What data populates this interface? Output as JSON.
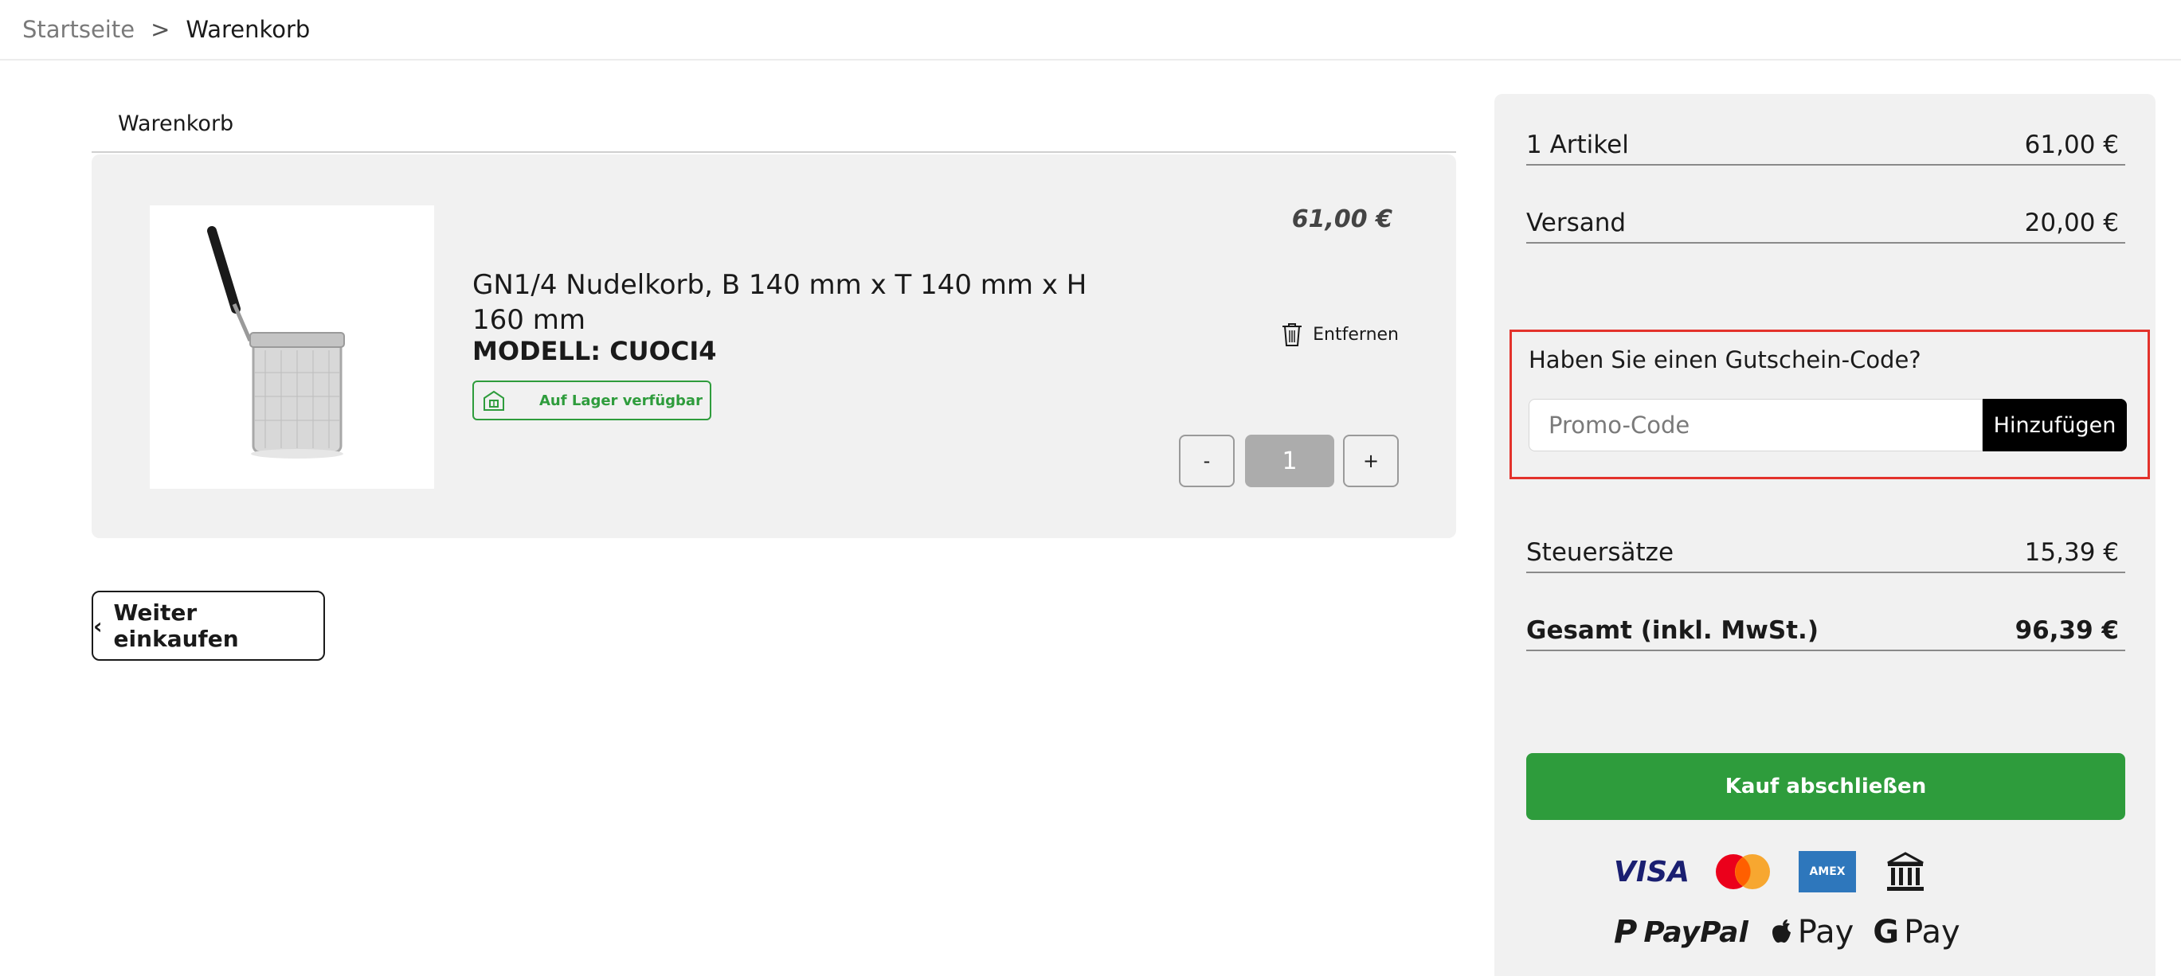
{
  "breadcrumb": {
    "home": "Startseite",
    "separator": ">",
    "current": "Warenkorb"
  },
  "cart": {
    "tab_label": "Warenkorb",
    "item": {
      "title": "GN1/4 Nudelkorb, B 140 mm x T 140 mm x H 160 mm",
      "model": "MODELL: CUOCI4",
      "stock": "Auf Lager verfügbar",
      "price": "61,00 €",
      "remove_label": "Entfernen",
      "quantity": "1",
      "minus_label": "-",
      "plus_label": "+",
      "image_icon": "pasta-basket-image"
    },
    "continue_label": "Weiter einkaufen"
  },
  "summary": {
    "articles_label": "1 Artikel",
    "articles_value": "61,00 €",
    "shipping_label": "Versand",
    "shipping_value": "20,00 €",
    "promo_question": "Haben Sie einen Gutschein-Code?",
    "promo_placeholder": "Promo-Code",
    "promo_button": "Hinzufügen",
    "tax_label": "Steuersätze",
    "tax_value": "15,39 €",
    "total_label": "Gesamt (inkl. MwSt.)",
    "total_value": "96,39 €",
    "checkout_label": "Kauf abschließen",
    "payment_methods": {
      "visa": "VISA",
      "amex": "AMEX",
      "paypal": "PayPal",
      "applepay": "Pay",
      "gpay_g": "G",
      "gpay": "Pay"
    }
  },
  "colors": {
    "accent_green": "#2e9c3c",
    "highlight_red": "#e3322b",
    "panel_gray": "#f1f1f1"
  }
}
